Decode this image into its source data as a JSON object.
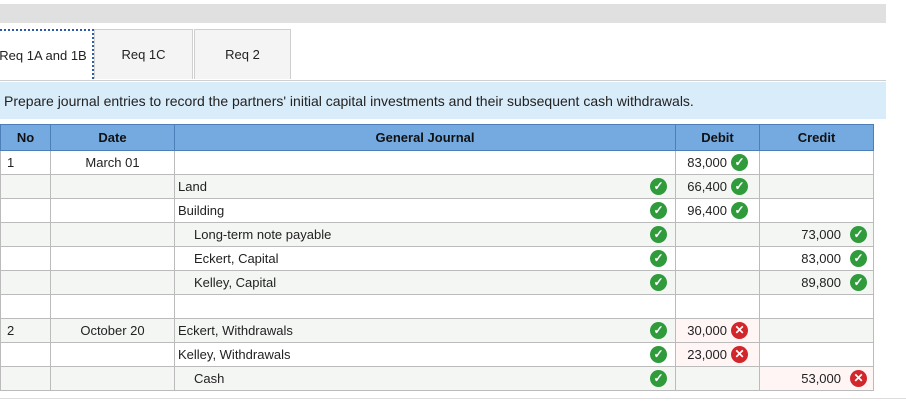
{
  "tabs": [
    {
      "label": "Req 1A and 1B",
      "active": true
    },
    {
      "label": "Req 1C",
      "active": false
    },
    {
      "label": "Req 2",
      "active": false
    }
  ],
  "instruction": "Prepare journal entries to record the partners' initial capital investments and their subsequent cash withdrawals.",
  "headers": {
    "no": "No",
    "date": "Date",
    "journal": "General Journal",
    "debit": "Debit",
    "credit": "Credit"
  },
  "rows": [
    {
      "no": "1",
      "date": "March 01",
      "account": "",
      "debit": "83,000",
      "credit": "",
      "debit_status": "correct"
    },
    {
      "no": "",
      "date": "",
      "account": "Land",
      "debit": "66,400",
      "credit": "",
      "acct_status": "correct",
      "debit_status": "correct"
    },
    {
      "no": "",
      "date": "",
      "account": "Building",
      "debit": "96,400",
      "credit": "",
      "acct_status": "correct",
      "debit_status": "correct"
    },
    {
      "no": "",
      "date": "",
      "account": "Long-term note payable",
      "indent": true,
      "debit": "",
      "credit": "73,000",
      "acct_status": "correct",
      "credit_status": "correct"
    },
    {
      "no": "",
      "date": "",
      "account": "Eckert, Capital",
      "indent": true,
      "debit": "",
      "credit": "83,000",
      "acct_status": "correct",
      "credit_status": "correct"
    },
    {
      "no": "",
      "date": "",
      "account": "Kelley, Capital",
      "indent": true,
      "debit": "",
      "credit": "89,800",
      "acct_status": "correct",
      "credit_status": "correct"
    },
    {
      "no": "",
      "date": "",
      "account": "",
      "debit": "",
      "credit": ""
    },
    {
      "no": "2",
      "date": "October 20",
      "account": "Eckert, Withdrawals",
      "debit": "30,000",
      "credit": "",
      "acct_status": "correct",
      "debit_status": "wrong"
    },
    {
      "no": "",
      "date": "",
      "account": "Kelley, Withdrawals",
      "debit": "23,000",
      "credit": "",
      "acct_status": "correct",
      "debit_status": "wrong"
    },
    {
      "no": "",
      "date": "",
      "account": "Cash",
      "indent": true,
      "debit": "",
      "credit": "53,000",
      "acct_status": "correct",
      "credit_status": "wrong"
    }
  ],
  "icons": {
    "correct": "check-icon",
    "wrong": "x-icon"
  },
  "colors": {
    "correct": "#2f9b3b",
    "wrong": "#d1262b",
    "header": "#74aadf",
    "instruction_bg": "#d9ecf9"
  }
}
